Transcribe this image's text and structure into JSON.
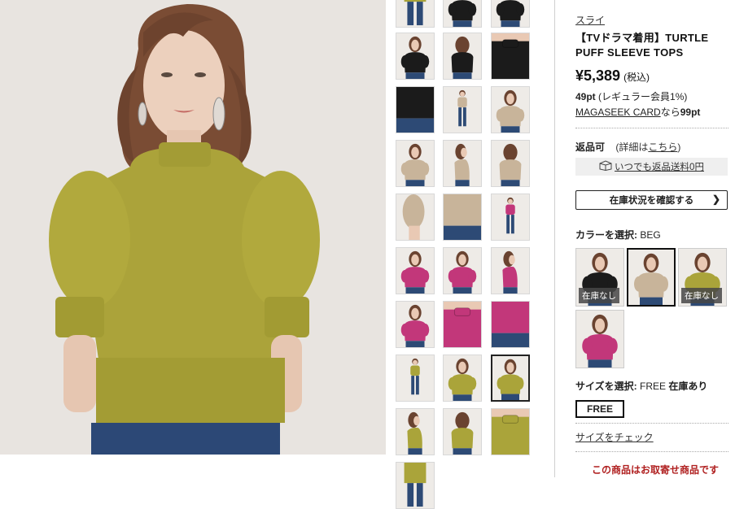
{
  "brand": "スライ",
  "product": {
    "title": "【TVドラマ着用】TURTLE PUFF SLEEVE TOPS",
    "price": "¥5,389",
    "tax": "(税込)",
    "points_value": "49pt",
    "points_note": "(レギュラー会員1%)",
    "card_name": "MAGASEEK CARD",
    "card_suffix": "なら",
    "card_points": "99pt"
  },
  "returns": {
    "label": "返品可",
    "note_prefix": "(詳細は",
    "note_link": "こちら",
    "note_suffix": ")",
    "button_label": "いつでも返品送料0円"
  },
  "stock_button": "在庫状況を確認する",
  "color": {
    "label": "カラーを選択:",
    "selected": "BEG",
    "swatches": [
      {
        "name": "black",
        "color": "#1b1b1b",
        "status": "在庫なし"
      },
      {
        "name": "beige",
        "color": "#c8b49a",
        "status": ""
      },
      {
        "name": "mustard",
        "color": "#aaa43a",
        "status": "在庫なし"
      },
      {
        "name": "pink",
        "color": "#c2377a",
        "status": ""
      }
    ]
  },
  "size": {
    "label": "サイズを選択:",
    "selected": "FREE",
    "stock": "在庫あり",
    "button": "FREE",
    "check_link": "サイズをチェック"
  },
  "notice": "この商品はお取寄せ商品です",
  "colors": {
    "mustard": "#aaa43a",
    "beige": "#c8b49a",
    "black": "#1b1b1b",
    "pink": "#c2377a",
    "denim": "#2d4a75",
    "skin": "#e9c9b4",
    "hair": "#6a4330"
  },
  "thumbs": [
    {
      "color": "mustard",
      "view": "legs"
    },
    {
      "color": "black",
      "view": "front-crop"
    },
    {
      "color": "black",
      "view": "front-crop"
    },
    {
      "color": "black",
      "view": "front"
    },
    {
      "color": "black",
      "view": "back"
    },
    {
      "color": "black",
      "view": "detail"
    },
    {
      "color": "black",
      "view": "detail-hem"
    },
    {
      "color": "beige",
      "view": "full"
    },
    {
      "color": "beige",
      "view": "front"
    },
    {
      "color": "beige",
      "view": "front"
    },
    {
      "color": "beige",
      "view": "side"
    },
    {
      "color": "beige",
      "view": "back"
    },
    {
      "color": "beige",
      "view": "sleeve"
    },
    {
      "color": "beige",
      "view": "detail-hem"
    },
    {
      "color": "pink",
      "view": "full"
    },
    {
      "color": "pink",
      "view": "front"
    },
    {
      "color": "pink",
      "view": "front"
    },
    {
      "color": "pink",
      "view": "side"
    },
    {
      "color": "pink",
      "view": "front"
    },
    {
      "color": "pink",
      "view": "detail"
    },
    {
      "color": "pink",
      "view": "detail-hem"
    },
    {
      "color": "mustard",
      "view": "full"
    },
    {
      "color": "mustard",
      "view": "front"
    },
    {
      "color": "mustard",
      "view": "front"
    },
    {
      "color": "mustard",
      "view": "side"
    },
    {
      "color": "mustard",
      "view": "back"
    },
    {
      "color": "mustard",
      "view": "detail"
    },
    {
      "color": "mustard",
      "view": "legs"
    }
  ],
  "selected_thumb": 23
}
